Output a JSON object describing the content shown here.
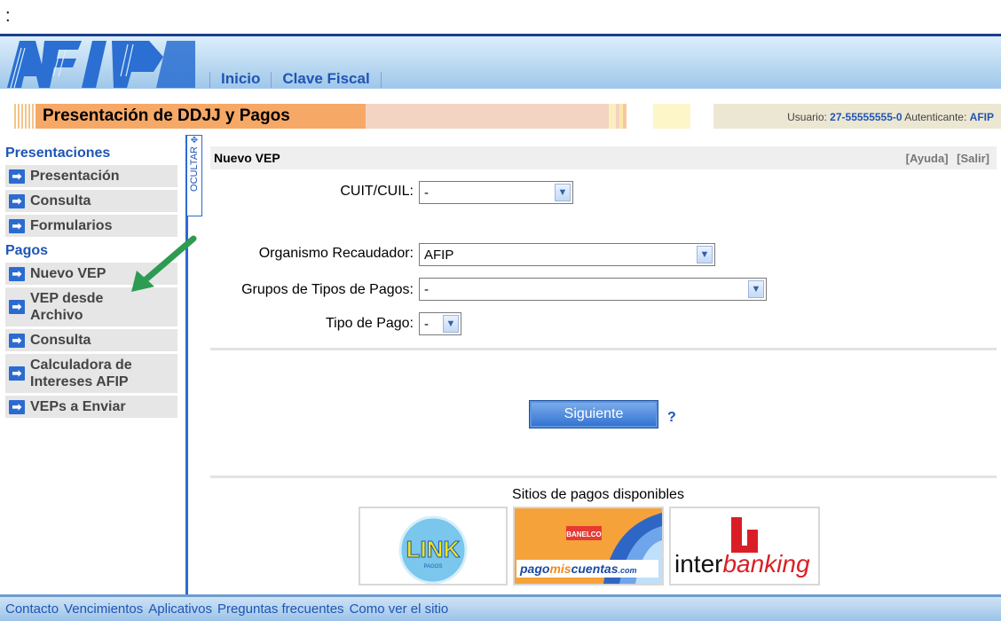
{
  "misc": {
    "colon": ":"
  },
  "header": {
    "logo_alt": "AFIP",
    "nav": [
      "Inicio",
      "Clave Fiscal"
    ]
  },
  "titlebar": {
    "title": "Presentación de DDJJ y Pagos",
    "user_label": "Usuario:",
    "user_value": "27-55555555-0",
    "auth_label": "Autenticante:",
    "auth_value": "AFIP"
  },
  "sidebar": {
    "sections": [
      {
        "title": "Presentaciones",
        "items": [
          "Presentación",
          "Consulta",
          "Formularios"
        ]
      },
      {
        "title": "Pagos",
        "items": [
          "Nuevo VEP",
          "VEP desde Archivo",
          "Consulta",
          "Calculadora de Intereses AFIP",
          "VEPs a Enviar"
        ]
      }
    ],
    "toggle_label": "OCULTAR"
  },
  "main": {
    "heading": "Nuevo VEP",
    "help_link": "[Ayuda]",
    "exit_link": "[Salir]",
    "fields": {
      "cuit": {
        "label": "CUIT/CUIL:",
        "value": "-"
      },
      "organismo": {
        "label": "Organismo Recaudador:",
        "value": "AFIP"
      },
      "grupos": {
        "label": "Grupos de Tipos de Pagos:",
        "value": "-"
      },
      "tipo": {
        "label": "Tipo de Pago:",
        "value": "-"
      }
    },
    "next_button": "Siguiente",
    "help_q": "?",
    "sites_title": "Sitios de pagos disponibles",
    "sites": {
      "link": {
        "text": "LINK",
        "sub": "PAGOS"
      },
      "pmc": {
        "brand": "BANELCO",
        "text_a": "pago",
        "text_b": "mis",
        "text_c": "cuentas",
        "text_d": ".com"
      },
      "interbanking": {
        "text_a": "inter",
        "text_b": "banking"
      }
    }
  },
  "footer": {
    "links": [
      "Contacto",
      "Vencimientos",
      "Aplicativos",
      "Preguntas frecuentes",
      "Como ver el sitio"
    ]
  },
  "colors": {
    "link_blue": "#1f55b4",
    "accent_blue": "#2b6bd0",
    "title_orange": "#f6a867",
    "arrow_green": "#2e9b52"
  }
}
